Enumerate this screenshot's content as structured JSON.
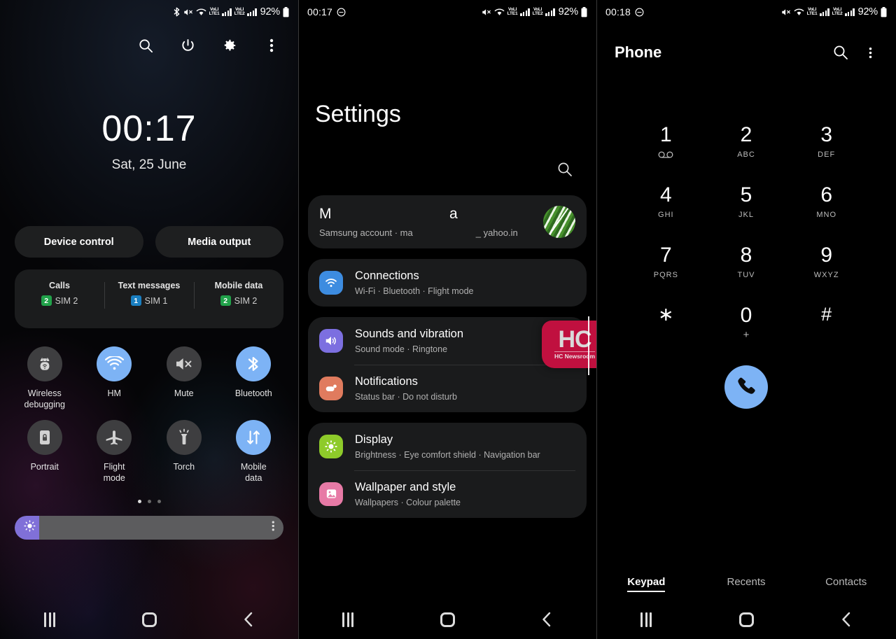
{
  "panel1": {
    "name": "quick-settings-panel",
    "statusbar": {
      "icons": [
        "bluetooth-icon",
        "mute-icon",
        "wifi-icon",
        "volte-sim1-icon",
        "signal-sim1-icon",
        "volte-sim2-icon",
        "signal-sim2-icon",
        "battery-icon"
      ],
      "volte1_top": "VoLI",
      "volte1_bottom": "LTE1",
      "volte2_top": "VoLI",
      "volte2_bottom": "LTE2",
      "battery": "92%"
    },
    "actions": [
      {
        "name": "search-icon",
        "label": "Search"
      },
      {
        "name": "power-icon",
        "label": "Power"
      },
      {
        "name": "gear-icon",
        "label": "Settings"
      },
      {
        "name": "more-options-icon",
        "label": "More options"
      }
    ],
    "clock": {
      "time": "00:17",
      "date": "Sat, 25 June"
    },
    "pills": [
      {
        "label": "Device control"
      },
      {
        "label": "Media output"
      }
    ],
    "sim_card": [
      {
        "title": "Calls",
        "badge": "2",
        "badge_color": "#21a24a",
        "label": "SIM 2"
      },
      {
        "title": "Text messages",
        "badge": "1",
        "badge_color": "#1a7fc1",
        "label": "SIM 1"
      },
      {
        "title": "Mobile data",
        "badge": "2",
        "badge_color": "#21a24a",
        "label": "SIM 2"
      }
    ],
    "tiles_row1": [
      {
        "label": "Wireless\ndebugging",
        "icon": "android-bug-icon",
        "state": "off"
      },
      {
        "label": "HM",
        "icon": "wifi-icon",
        "state": "on"
      },
      {
        "label": "Mute",
        "icon": "mute-icon",
        "state": "off"
      },
      {
        "label": "Bluetooth",
        "icon": "bluetooth-icon",
        "state": "on"
      }
    ],
    "tiles_row2": [
      {
        "label": "Portrait",
        "icon": "screen-rotation-lock-icon",
        "state": "off"
      },
      {
        "label": "Flight\nmode",
        "icon": "airplane-icon",
        "state": "off"
      },
      {
        "label": "Torch",
        "icon": "flashlight-icon",
        "state": "off"
      },
      {
        "label": "Mobile\ndata",
        "icon": "data-transfer-icon",
        "state": "on"
      }
    ],
    "page_dots": {
      "count": 3,
      "active_index": 0
    },
    "brightness": {
      "name": "brightness-slider",
      "fill_percent": 9,
      "fill_color": "#8070d8",
      "track_color": "#5c5c5e"
    }
  },
  "panel2": {
    "name": "settings-panel",
    "statusbar": {
      "clock": "00:17",
      "dnd_icon": "do-not-disturb-icon",
      "battery": "92%"
    },
    "title": "Settings",
    "search_icon": "search-icon",
    "account": {
      "name_visible_start": "M",
      "name_visible_mid": "a",
      "sub_prefix": "Samsung account",
      "sub_sep": "·",
      "sub_mid": "ma",
      "sub_end": "_ yahoo.in",
      "avatar": "avatar-fern-photo"
    },
    "groups": [
      {
        "items": [
          {
            "title": "Connections",
            "sub": "Wi-Fi · Bluetooth · Flight mode",
            "icon": "wifi-icon",
            "icon_color": "#3d8ce0"
          }
        ]
      },
      {
        "items": [
          {
            "title": "Sounds and vibration",
            "sub": "Sound mode · Ringtone",
            "icon": "speaker-icon",
            "icon_color": "#7c6fe0"
          },
          {
            "title": "Notifications",
            "sub": "Status bar · Do not disturb",
            "icon": "notification-icon",
            "icon_color": "#e07b5e"
          }
        ]
      },
      {
        "items": [
          {
            "title": "Display",
            "sub": "Brightness · Eye comfort shield · Navigation bar",
            "icon": "brightness-icon",
            "icon_color": "#8ecb2a"
          },
          {
            "title": "Wallpaper and style",
            "sub": "Wallpapers · Colour palette",
            "icon": "image-icon",
            "icon_color": "#e77aa6"
          }
        ]
      }
    ],
    "watermark": {
      "logo": "HC",
      "caption": "HC Newsroom",
      "color": "#c0103f"
    }
  },
  "panel3": {
    "name": "phone-panel",
    "statusbar": {
      "clock": "00:18",
      "dnd_icon": "do-not-disturb-icon",
      "battery": "92%"
    },
    "title": "Phone",
    "actions": [
      {
        "name": "search-icon",
        "label": "Search"
      },
      {
        "name": "more-options-icon",
        "label": "More options"
      }
    ],
    "dialpad": [
      [
        {
          "num": "1",
          "sub": "",
          "vm": true
        },
        {
          "num": "2",
          "sub": "ABC"
        },
        {
          "num": "3",
          "sub": "DEF"
        }
      ],
      [
        {
          "num": "4",
          "sub": "GHI"
        },
        {
          "num": "5",
          "sub": "JKL"
        },
        {
          "num": "6",
          "sub": "MNO"
        }
      ],
      [
        {
          "num": "7",
          "sub": "PQRS"
        },
        {
          "num": "8",
          "sub": "TUV"
        },
        {
          "num": "9",
          "sub": "WXYZ"
        }
      ],
      [
        {
          "num": "∗",
          "sub": "",
          "sym": true
        },
        {
          "num": "0",
          "sub": "+",
          "plus": true
        },
        {
          "num": "#",
          "sub": "",
          "sym": true
        }
      ]
    ],
    "call_button": {
      "name": "call-button",
      "icon": "phone-handset-icon",
      "color": "#7db3f5"
    },
    "tabs": [
      {
        "label": "Keypad",
        "active": true
      },
      {
        "label": "Recents",
        "active": false
      },
      {
        "label": "Contacts",
        "active": false
      }
    ]
  },
  "navbar": {
    "recent_icon": "recent-apps-icon",
    "home_icon": "home-icon",
    "back_icon": "back-icon"
  }
}
